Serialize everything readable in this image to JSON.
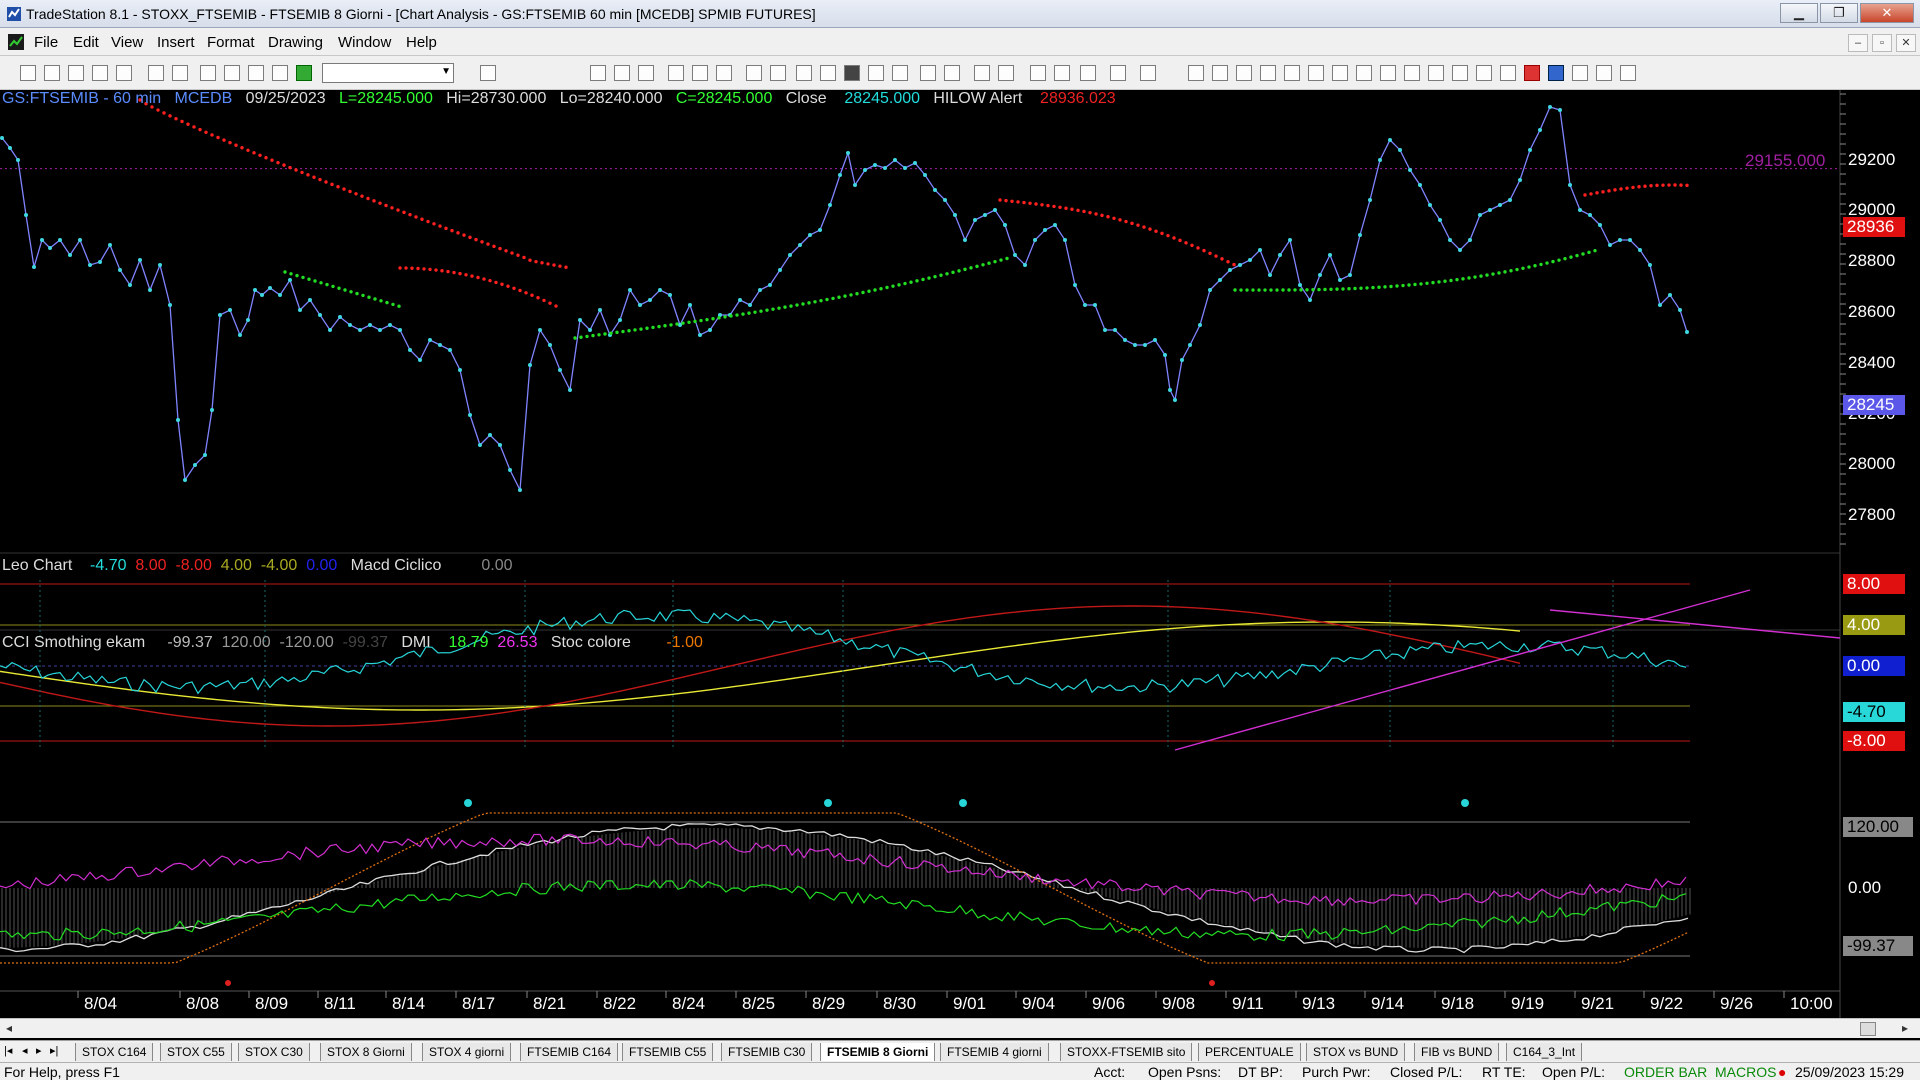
{
  "window": {
    "title": "TradeStation 8.1 - STOXX_FTSEMIB - FTSEMIB  8 Giorni - [Chart Analysis - GS:FTSEMIB  60 min  [MCEDB] SPMIB FUTURES]",
    "minimize_label": "▁",
    "restore_label": "❐",
    "close_label": "✕"
  },
  "menu": {
    "items": [
      "File",
      "Edit",
      "View",
      "Insert",
      "Format",
      "Drawing",
      "Window",
      "Help"
    ],
    "mdi_buttons": [
      "–",
      "▫",
      "✕"
    ]
  },
  "toolbar": {
    "symbol_value": ""
  },
  "chart": {
    "header": {
      "symbol": "GS:FTSEMIB - 60 min",
      "feed": "MCEDB",
      "date": "09/25/2023",
      "last": "L=28245.000",
      "high": "Hi=28730.000",
      "low": "Lo=28240.000",
      "close": "C=28245.000",
      "close_label": "Close",
      "close_value": "28245.000",
      "alert_label": "HILOW Alert",
      "alert_value": "28936.023"
    },
    "price_axis": {
      "ticks": [
        "29200",
        "29000",
        "28800",
        "28600",
        "28400",
        "28200",
        "28000",
        "27800"
      ],
      "ref_label": "29155.000",
      "red_marker": "28936",
      "last_marker": "28245"
    },
    "osc_panel": {
      "header": {
        "name": "Leo Chart",
        "v1": "-4.70",
        "v2": "8.00",
        "v3": "-8.00",
        "v4": "4.00",
        "v5": "-4.00",
        "v6": "0.00",
        "name2": "Macd Ciclico",
        "v7": "0.00"
      },
      "axis": {
        "t1": "8.00",
        "t2": "4.00",
        "t3": "0.00",
        "t4": "-4.70",
        "t5": "-8.00"
      }
    },
    "cci_panel": {
      "header": {
        "name": "CCI Smothing ekam",
        "v1": "-99.37",
        "v2": "120.00",
        "v3": "-120.00",
        "v4": "-99.37",
        "dmi": "DMI",
        "d1": "18.79",
        "d2": "26.53",
        "stoc": "Stoc colore",
        "s1": "-1.00"
      },
      "axis": {
        "t1": "120.00",
        "t2": "0.00",
        "t3": "-99.37"
      }
    },
    "x_axis": [
      "8/04",
      "8/08",
      "8/09",
      "8/11",
      "8/14",
      "8/17",
      "8/21",
      "8/22",
      "8/24",
      "8/25",
      "8/29",
      "8/30",
      "9/01",
      "9/04",
      "9/06",
      "9/08",
      "9/11",
      "9/13",
      "9/14",
      "9/18",
      "9/19",
      "9/21",
      "9/22",
      "9/26",
      "10:00"
    ],
    "colors": {
      "price": "#7f84ff",
      "dots": "#3fd7e0",
      "red_curve": "#ff2020",
      "green_curve": "#22dd22",
      "osc_cyan": "#27d5d8",
      "osc_yellow": "#e9e935",
      "osc_red": "#c01818",
      "magenta": "#d22fd2"
    }
  },
  "tabs": {
    "items": [
      "STOX C164",
      "STOX C55",
      "STOX  C30",
      "STOX  8 Giorni",
      "STOX 4 giorni",
      "FTSEMIB C164",
      "FTSEMIB C55",
      "FTSEMIB C30",
      "FTSEMIB  8 Giorni",
      "FTSEMIB  4 giorni",
      "STOXX-FTSEMIB sito",
      "PERCENTUALE",
      "STOX vs BUND",
      "FIB vs BUND",
      "C164_3_Int"
    ],
    "active_index": 8
  },
  "status": {
    "help": "For Help, press F1",
    "acct": "Acct:",
    "open_psns": "Open Psns:",
    "dt_bp": "DT BP:",
    "purch_pwr": "Purch Pwr:",
    "closed_pl": "Closed P/L:",
    "rt_te": "RT TE:",
    "open_pl": "Open P/L:",
    "order_bar": "ORDER BAR",
    "macros": "MACROS",
    "datetime": "25/09/2023 15:29"
  }
}
